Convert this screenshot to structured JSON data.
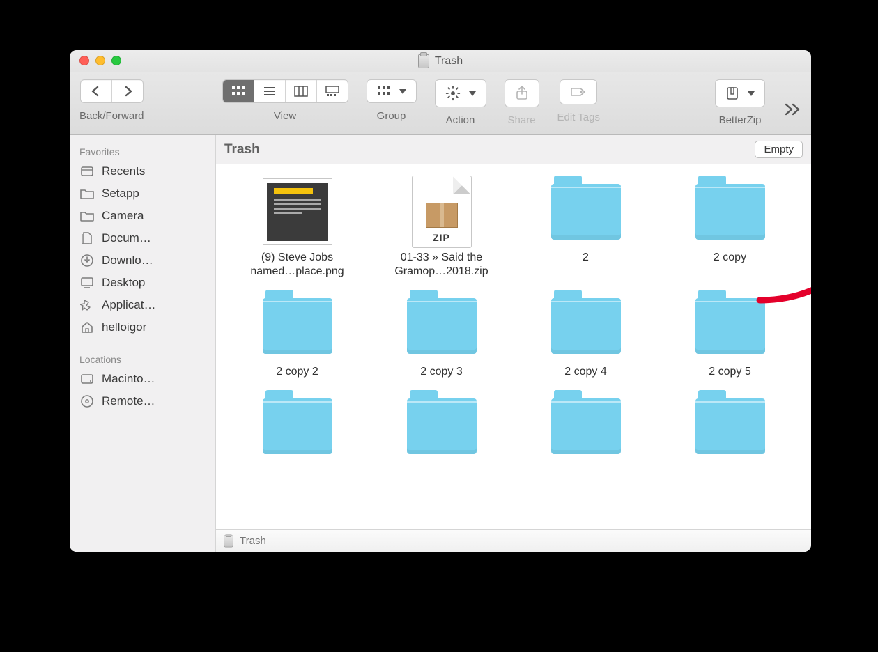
{
  "window": {
    "title": "Trash"
  },
  "toolbar": {
    "back_forward_label": "Back/Forward",
    "view_label": "View",
    "group_label": "Group",
    "action_label": "Action",
    "share_label": "Share",
    "tags_label": "Edit Tags",
    "betterzip_label": "BetterZip"
  },
  "sidebar": {
    "section_favorites": "Favorites",
    "section_locations": "Locations",
    "favorites": [
      {
        "id": "recents",
        "label": "Recents"
      },
      {
        "id": "setapp",
        "label": "Setapp"
      },
      {
        "id": "camera",
        "label": "Camera"
      },
      {
        "id": "documents",
        "label": "Docum…"
      },
      {
        "id": "downloads",
        "label": "Downlo…"
      },
      {
        "id": "desktop",
        "label": "Desktop"
      },
      {
        "id": "apps",
        "label": "Applicat…"
      },
      {
        "id": "home",
        "label": "helloigor"
      }
    ],
    "locations": [
      {
        "id": "macintosh",
        "label": "Macinto…"
      },
      {
        "id": "remote",
        "label": "Remote…"
      }
    ]
  },
  "location_bar": {
    "title": "Trash",
    "empty_button": "Empty"
  },
  "items": [
    {
      "type": "image",
      "label_line1": "(9) Steve Jobs",
      "label_line2": "named…place.png"
    },
    {
      "type": "zip",
      "label_line1": "01-33 » Said the",
      "label_line2": "Gramop…2018.zip",
      "zip_badge": "ZIP"
    },
    {
      "type": "folder",
      "label_line1": "2",
      "label_line2": ""
    },
    {
      "type": "folder",
      "label_line1": "2 copy",
      "label_line2": ""
    },
    {
      "type": "folder",
      "label_line1": "2 copy 2",
      "label_line2": ""
    },
    {
      "type": "folder",
      "label_line1": "2 copy 3",
      "label_line2": ""
    },
    {
      "type": "folder",
      "label_line1": "2 copy 4",
      "label_line2": ""
    },
    {
      "type": "folder",
      "label_line1": "2 copy 5",
      "label_line2": ""
    },
    {
      "type": "folder",
      "label_line1": "",
      "label_line2": ""
    },
    {
      "type": "folder",
      "label_line1": "",
      "label_line2": ""
    },
    {
      "type": "folder",
      "label_line1": "",
      "label_line2": ""
    },
    {
      "type": "folder",
      "label_line1": "",
      "label_line2": ""
    }
  ],
  "pathbar": {
    "label": "Trash"
  }
}
